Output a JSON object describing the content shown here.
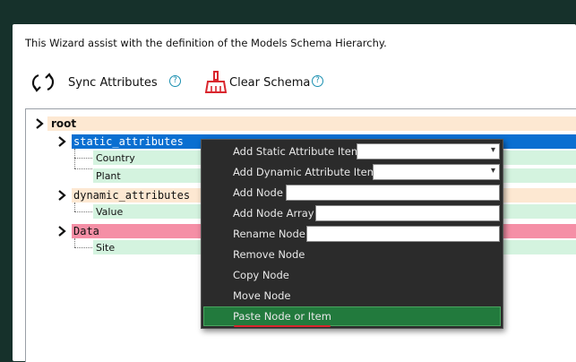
{
  "intro": "This Wizard assist with the definition of the Models Schema Hierarchy.",
  "toolbar": {
    "sync_label": "Sync Attributes",
    "clear_label": "Clear Schema",
    "help_glyph": "?",
    "sync_icon": "sync-icon",
    "clear_icon": "broom-icon"
  },
  "tree": {
    "root": "root",
    "static_attributes": {
      "label": "static_attributes",
      "children": [
        "Country",
        "Plant"
      ]
    },
    "dynamic_attributes": {
      "label": "dynamic_attributes",
      "children": [
        "Value"
      ]
    },
    "data": {
      "label": "Data",
      "children": [
        "Site"
      ]
    }
  },
  "context_menu": {
    "items": [
      "Add Static Attribute Item",
      "Add Dynamic Attribute Item",
      "Add Node",
      "Add Node Array",
      "Rename Node",
      "Remove Node",
      "Copy Node",
      "Move Node",
      "Paste Node or Item"
    ],
    "active_item": "Paste Node or Item"
  },
  "colors": {
    "background": "#16312b",
    "root_bar": "#fde8d2",
    "static_bar": "#0a6fd1",
    "leaf_bar": "#d4f3df",
    "dynamic_bar": "#fde8d2",
    "data_bar": "#f58fa6",
    "menu_bg": "#2b2b2b",
    "menu_active": "#227a3d",
    "help": "#1a8fb0",
    "broom": "#d9262e"
  }
}
